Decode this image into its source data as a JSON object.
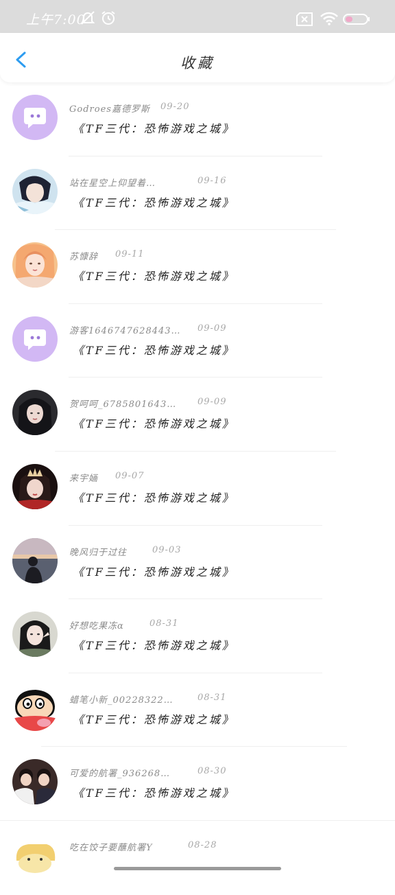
{
  "status_bar": {
    "time": "上午7:00"
  },
  "header": {
    "title": "收藏"
  },
  "items": [
    {
      "name": "Godroes嘉德罗斯",
      "date": "09-20",
      "content": "《TF三代：恐怖游戏之城》",
      "avatar": "default"
    },
    {
      "name": "站在星空上仰望着…",
      "date": "09-16",
      "content": "《TF三代：恐怖游戏之城》",
      "avatar": "anime-boy"
    },
    {
      "name": "苏慷辞",
      "date": "09-11",
      "content": "《TF三代：恐怖游戏之城》",
      "avatar": "illustrated-girl"
    },
    {
      "name": "游客1646747628443…",
      "date": "09-09",
      "content": "《TF三代：恐怖游戏之城》",
      "avatar": "default"
    },
    {
      "name": "贺呵呵_6785801643…",
      "date": "09-09",
      "content": "《TF三代：恐怖游戏之城》",
      "avatar": "dark-hair-girl"
    },
    {
      "name": "来宇婳",
      "date": "09-07",
      "content": "《TF三代：恐怖游戏之城》",
      "avatar": "crown-girl"
    },
    {
      "name": "晚风归于过往",
      "date": "09-03",
      "content": "《TF三代：恐怖游戏之城》",
      "avatar": "silhouette"
    },
    {
      "name": "好想吃果冻α",
      "date": "08-31",
      "content": "《TF三代：恐怖游戏之城》",
      "avatar": "selfie-girl"
    },
    {
      "name": "蜡笔小新_00228322…",
      "date": "08-31",
      "content": "《TF三代：恐怖游戏之城》",
      "avatar": "cartoon"
    },
    {
      "name": "可爱的航署_936268…",
      "date": "08-30",
      "content": "《TF三代：恐怖游戏之城》",
      "avatar": "two-boys"
    },
    {
      "name": "吃在饺子要蘸航署Y",
      "date": "08-28",
      "content": "",
      "avatar": "cartoon-yellow"
    }
  ]
}
